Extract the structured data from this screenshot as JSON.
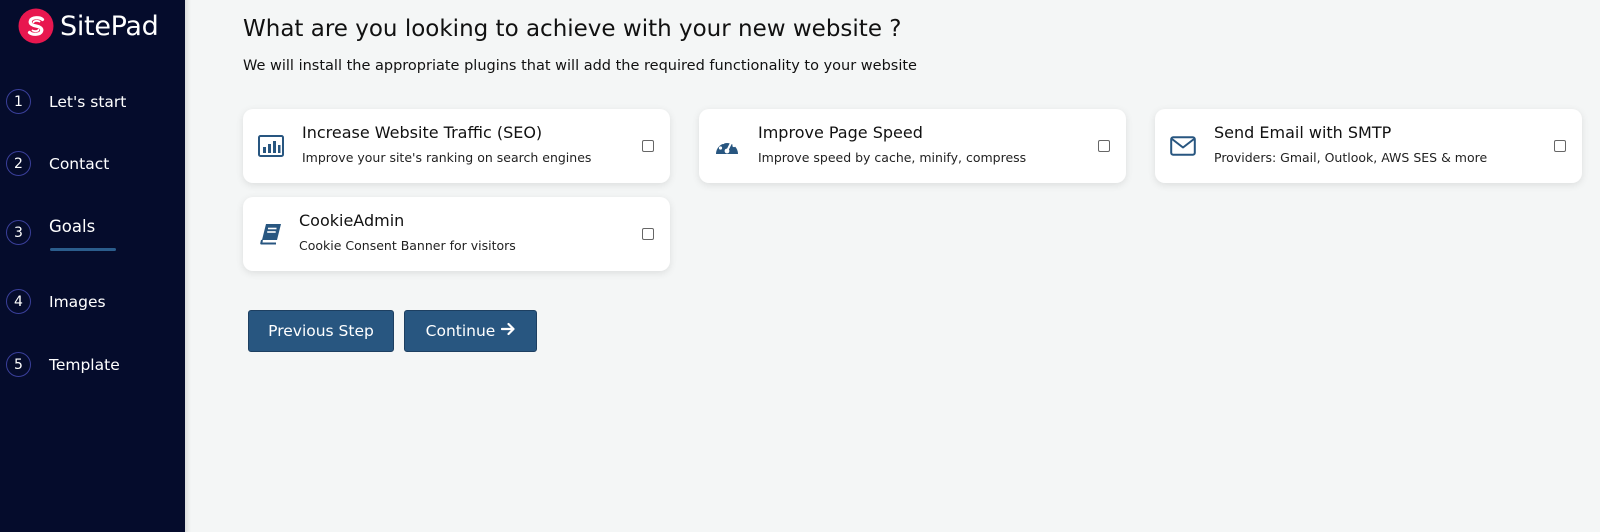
{
  "brand": {
    "name": "SitePad"
  },
  "steps": [
    {
      "number": "1",
      "label": "Let's start"
    },
    {
      "number": "2",
      "label": "Contact"
    },
    {
      "number": "3",
      "label": "Goals"
    },
    {
      "number": "4",
      "label": "Images"
    },
    {
      "number": "5",
      "label": "Template"
    }
  ],
  "active_step": "Goals",
  "page": {
    "title": "What are you looking to achieve with your new website ?",
    "subtitle": "We will install the appropriate plugins that will add the required functionality to your website"
  },
  "goals": [
    {
      "icon": "bar-chart-icon",
      "title": "Increase Website Traffic (SEO)",
      "description": "Improve your site's ranking on search engines",
      "checked": false
    },
    {
      "icon": "speedometer-icon",
      "title": "Improve Page Speed",
      "description": "Improve speed by cache, minify, compress",
      "checked": false
    },
    {
      "icon": "envelope-icon",
      "title": "Send Email with SMTP",
      "description": "Providers: Gmail, Outlook, AWS SES & more",
      "checked": false
    },
    {
      "icon": "book-icon",
      "title": "CookieAdmin",
      "description": "Cookie Consent Banner for visitors",
      "checked": false
    }
  ],
  "buttons": {
    "previous": "Previous Step",
    "continue": "Continue"
  },
  "colors": {
    "sidebar_bg": "#050c2c",
    "accent": "#285680",
    "logo": "#e8174f",
    "page_bg": "#f4f6f6"
  }
}
